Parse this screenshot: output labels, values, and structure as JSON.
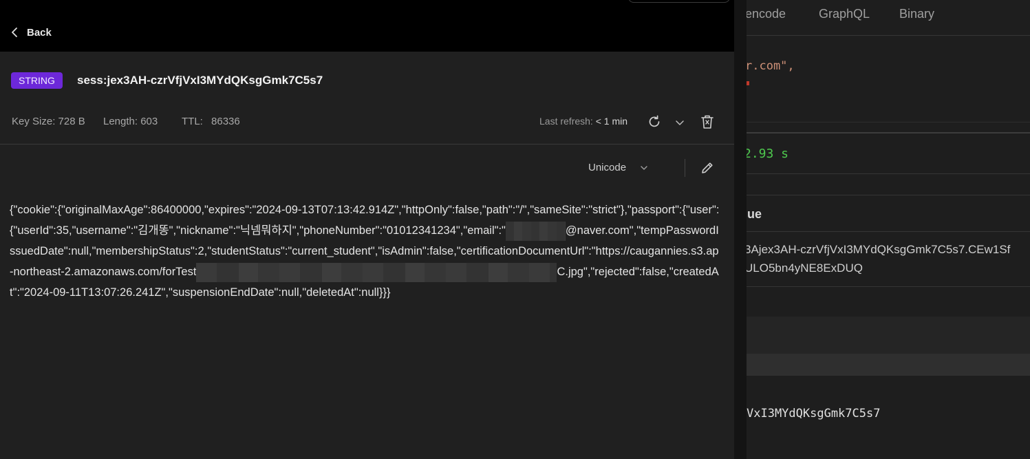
{
  "header": {
    "back_label": "Back"
  },
  "key": {
    "type": "STRING",
    "name": "sess:jex3AH-czrVfjVxI3MYdQKsgGmk7C5s7",
    "key_size_label": "Key Size:",
    "key_size_value": "728 B",
    "length_label": "Length:",
    "length_value": "603",
    "ttl_label": "TTL:",
    "ttl_value": "86336",
    "last_refresh_label": "Last refresh:",
    "last_refresh_value": "< 1 min"
  },
  "value_view": {
    "encoding": "Unicode",
    "text_part1": "{\"cookie\":{\"originalMaxAge\":86400000,\"expires\":\"2024-09-13T07:13:42.914Z\",\"httpOnly\":false,\"path\":\"/\",\"sameSite\":\"strict\"},\"passport\":{\"user\":{\"userId\":35,\"username\":\"김개똥\",\"nickname\":\"닉넴뭐하지\",\"phoneNumber\":\"01012341234\",\"email\":\"",
    "text_part2": "@naver.com\",\"tempPasswordIssuedDate\":null,\"membershipStatus\":2,\"studentStatus\":\"current_student\",\"isAdmin\":false,\"certificationDocumentUrl\":\"https://caugannies.s3.ap-northeast-2.amazonaws.com/forTest",
    "text_part3": "C.jpg\",\"rejected\":false,\"createdAt\":\"2024-09-11T13:07:26.241Z\",\"suspensionEndDate\":null,\"deletedAt\":null}}}"
  },
  "right_panel": {
    "tabs": [
      "encode",
      "GraphQL",
      "Binary"
    ],
    "code_line1": "r.com\",",
    "time": "2.93 s",
    "section_label": "lue",
    "value_line1": "3Ajex3AH-czrVfjVxI3MYdQKsgGmk7C5s7.CEw1Sf",
    "value_line2": "ULO5bn4yNE8ExDUQ",
    "bottom_line": "VxI3MYdQKsgGmk7C5s7"
  },
  "colors": {
    "badge": "#6d28d9",
    "time_green": "#4ec94e",
    "string_orange": "#ce9178"
  }
}
